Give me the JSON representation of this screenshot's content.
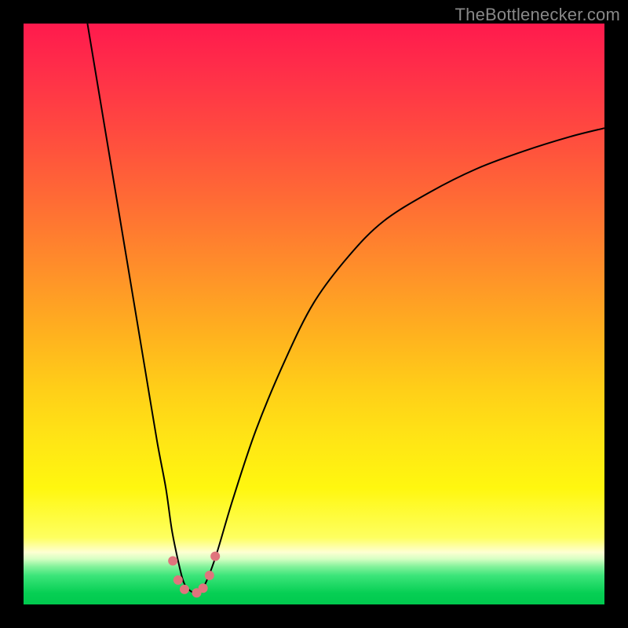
{
  "watermark": {
    "text": "TheBottlenecker.com"
  },
  "chart_data": {
    "type": "line",
    "title": "",
    "xlabel": "",
    "ylabel": "",
    "xlim": [
      0,
      100
    ],
    "ylim": [
      0,
      100
    ],
    "grid": false,
    "series": [
      {
        "name": "bottleneck-curve",
        "x": [
          11,
          13,
          15,
          17,
          19,
          21,
          23,
          24.5,
          25.5,
          26.5,
          27.5,
          28.5,
          29.8,
          31,
          33,
          36,
          40,
          45,
          50,
          56,
          62,
          70,
          78,
          86,
          94,
          100
        ],
        "y": [
          100,
          88,
          76,
          64,
          52,
          40,
          28,
          20,
          13,
          8,
          4,
          2.5,
          2,
          3,
          8,
          18,
          30,
          42,
          52,
          60,
          66,
          71,
          75,
          78,
          80.5,
          82
        ]
      }
    ],
    "markers": [
      {
        "name": "pt1",
        "x": 25.7,
        "y": 7.5,
        "r": 6
      },
      {
        "name": "pt2",
        "x": 26.6,
        "y": 4.2,
        "r": 6
      },
      {
        "name": "pt3",
        "x": 27.7,
        "y": 2.6,
        "r": 6
      },
      {
        "name": "pt4",
        "x": 29.8,
        "y": 2.0,
        "r": 6
      },
      {
        "name": "pt5",
        "x": 30.9,
        "y": 2.8,
        "r": 6
      },
      {
        "name": "pt6",
        "x": 32.0,
        "y": 5.0,
        "r": 6
      },
      {
        "name": "pt7",
        "x": 33.0,
        "y": 8.3,
        "r": 6
      }
    ],
    "curve_color": "#000000",
    "curve_width": 2,
    "marker_color": "#e0747d",
    "gradient_stops": [
      {
        "pos": 0,
        "color": "#ff1a4d"
      },
      {
        "pos": 0.5,
        "color": "#ffb01f"
      },
      {
        "pos": 0.88,
        "color": "#feff60"
      },
      {
        "pos": 1.0,
        "color": "#00c94e"
      }
    ]
  }
}
